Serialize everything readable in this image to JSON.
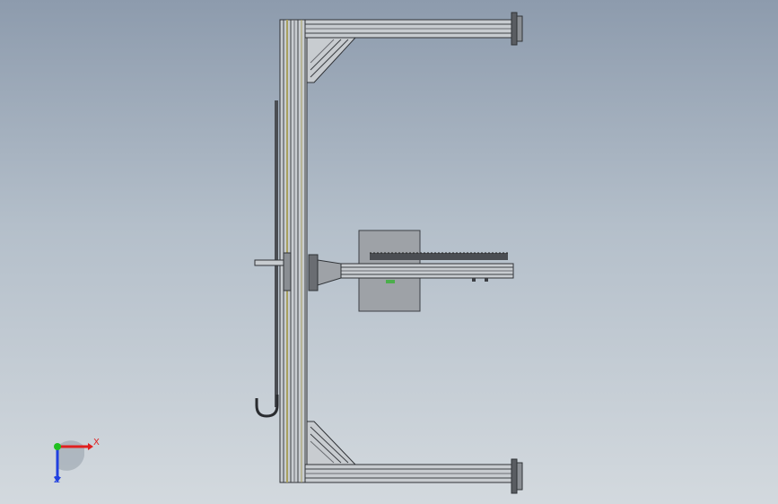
{
  "viewport": {
    "background_top": "#8d9bad",
    "background_bottom": "#d3d9de"
  },
  "model": {
    "frame_color": "#4a4d52",
    "frame_light": "#c8ccd0",
    "accent_yellow": "#a8a060",
    "motor_plate_color": "#9ea2a7",
    "icons": [
      "gantry-frame-icon",
      "carriage-plate-icon",
      "hook-icon",
      "rack-icon"
    ]
  },
  "triad": {
    "x_label": "X",
    "z_label": "Z",
    "x_color": "#e02020",
    "y_color": "#20c020",
    "z_color": "#2040e0"
  }
}
